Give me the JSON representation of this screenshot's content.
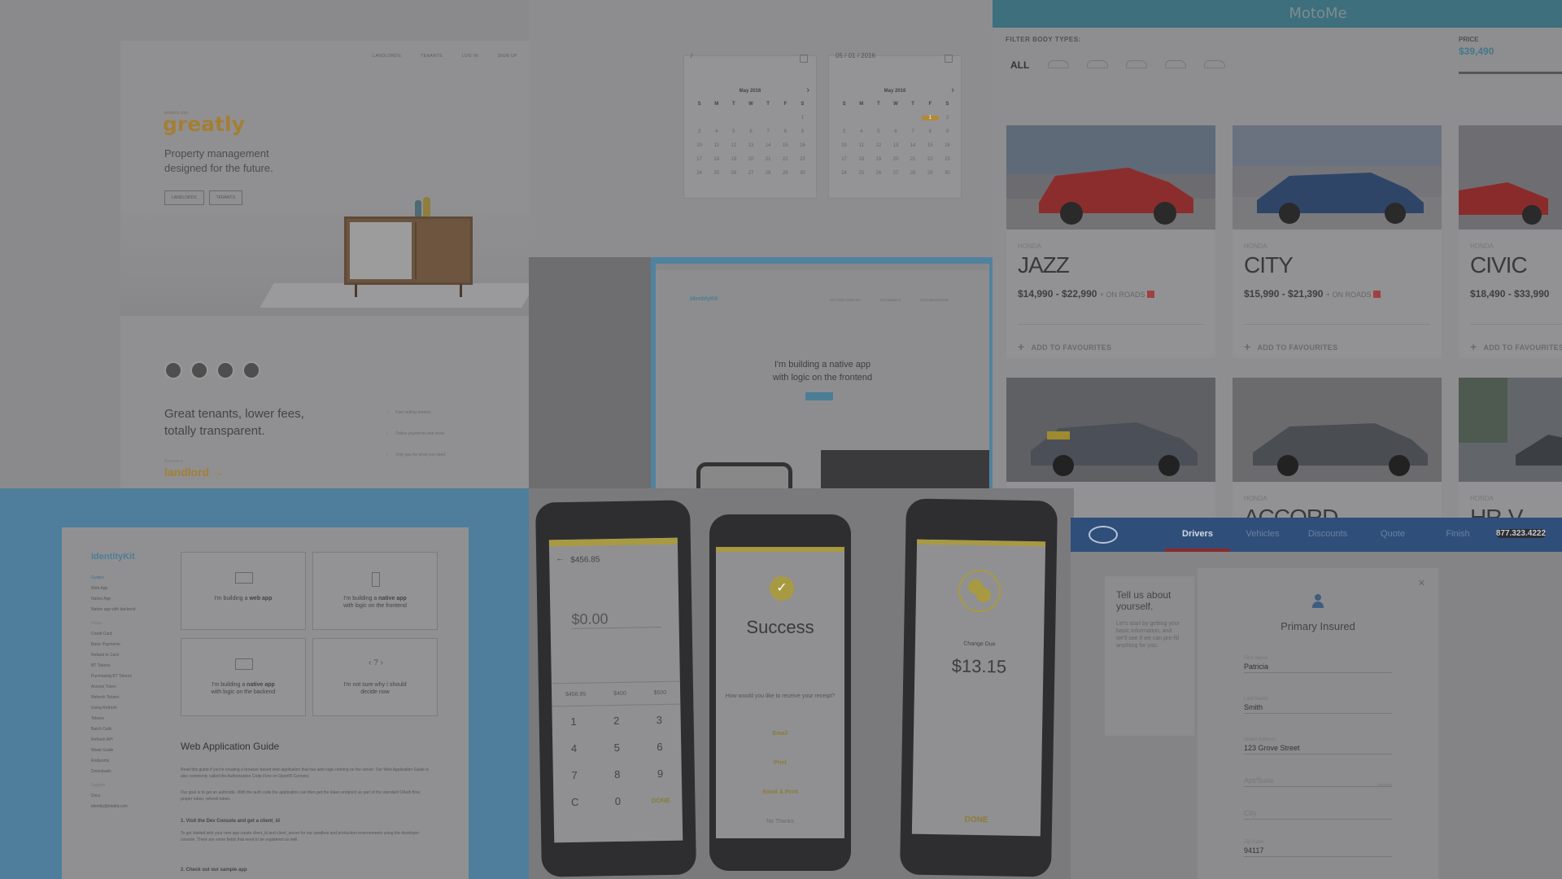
{
  "greatly": {
    "nav": [
      "LANDLORDS",
      "TENANTS",
      "LOG IN",
      "SIGN UP"
    ],
    "eyebrow": "property.com",
    "logo": "greatly",
    "tagline": "Property management designed for the future.",
    "buttons": [
      "LANDLORDS",
      "TENANTS"
    ],
    "headline": "Great tenants, lower fees, totally transparent.",
    "features": [
      "Fast vetting tenants",
      "Online payments and more",
      "Only pay for what you need"
    ],
    "eyebrow2": "Become a",
    "link": "landlord →"
  },
  "calendar": {
    "left_input": "/",
    "right_input": "05 / 01 / 2016",
    "month": "May 2016",
    "weekdays": [
      "S",
      "M",
      "T",
      "W",
      "T",
      "F",
      "S"
    ],
    "left_days": [
      "",
      "",
      "",
      "",
      "",
      "",
      "1",
      "3",
      "4",
      "5",
      "6",
      "7",
      "8",
      "9",
      "10",
      "11",
      "12",
      "13",
      "14",
      "15",
      "16",
      "17",
      "18",
      "19",
      "20",
      "21",
      "22",
      "23",
      "24",
      "25",
      "26",
      "27",
      "28",
      "29",
      "30"
    ],
    "right_days": [
      "",
      "",
      "",
      "",
      "",
      "1",
      "2",
      "3",
      "4",
      "5",
      "6",
      "7",
      "8",
      "9",
      "10",
      "11",
      "12",
      "13",
      "14",
      "15",
      "16",
      "17",
      "18",
      "19",
      "20",
      "21",
      "22",
      "23",
      "24",
      "25",
      "26",
      "27",
      "28",
      "29",
      "30"
    ],
    "selected": "1"
  },
  "identitykit_small": {
    "brand": "IdentityKit",
    "links": [
      "GETTING STARTED",
      "DOCUMENTS",
      "DOCUMENTATION"
    ],
    "message_line1": "I'm building a native app",
    "message_line2": "with logic on the frontend"
  },
  "motome": {
    "title": "MotoMe",
    "filter_label": "FILTER BODY TYPES:",
    "all": "ALL",
    "price_label": "PRICE",
    "price_value": "$39,490",
    "on_roads": "+ ON ROADS",
    "add_fav": "ADD TO FAVOURITES",
    "cars": [
      {
        "make": "HONDA",
        "model": "JAZZ",
        "range": "$14,990 - $22,990"
      },
      {
        "make": "HONDA",
        "model": "CITY",
        "range": "$15,990 - $21,390"
      },
      {
        "make": "HONDA",
        "model": "CIVIC",
        "range": "$18,490 - $33,990"
      }
    ],
    "cars_row2": [
      {
        "make": "HONDA",
        "model": "ACCORD"
      },
      {
        "make": "HONDA",
        "model": "HR-V"
      }
    ]
  },
  "identitykit_doc": {
    "brand": "IdentityKit",
    "sidebar": [
      "Guides",
      "Web App",
      "Native App",
      "Native app with backend",
      "Flows",
      "Credit Card",
      "Basic Payments",
      "Refund to Card",
      "BT Tokens",
      "Purchasing BT Tokens",
      "Access Token",
      "Refresh Tokens",
      "Using Refresh",
      "Tokens",
      "Batch Calls",
      "Refresh API",
      "Weak Guide",
      "Endpoints",
      "Downloads",
      "Support",
      "Docs",
      "identity@iotakit.com"
    ],
    "options": [
      {
        "label_plain": "I'm building a ",
        "label_bold": "web app",
        "label_tail": ""
      },
      {
        "label_plain": "I'm building a ",
        "label_bold": "native app",
        "label_tail": "with logic on the frontend"
      },
      {
        "label_plain": "I'm building a ",
        "label_bold": "native app",
        "label_tail": "with logic on the backend"
      },
      {
        "label_plain": "I'm not sure why I should",
        "label_bold": "",
        "label_tail": "decide now"
      }
    ],
    "guide_title": "Web Application Guide",
    "para1": "Read this guide if you're creating a browser-based web application that has web logic running on the server. Our Web Application Guide is also commonly called the Authorization Code Flow on OpenID Connect.",
    "para2": "Our goal is to get an authcode. With the auth code the application can then get the token endpoint as part of the standard OAuth flow, proper token, refresh token.",
    "step1": "1. Visit the Dev Console and get a client_id",
    "para3": "To get started with your new app create client_id and client_secret for our sandbox and production environments using the developer console. There are some fields that need to be registered as well.",
    "step2": "2. Check out our sample app"
  },
  "phones": {
    "p1_balance": "$456.85",
    "p1_amount": "$0.00",
    "p1_quick": [
      "$456.85",
      "$400",
      "$500"
    ],
    "p1_keys": [
      "1",
      "2",
      "3",
      "4",
      "5",
      "6",
      "7",
      "8",
      "9",
      "C",
      "0",
      "DONE"
    ],
    "p2_title": "Success",
    "p2_question": "How would you like to receive your receipt?",
    "p2_options": [
      "Email",
      "Print",
      "Email & Print",
      "No Thanks"
    ],
    "p3_label": "Change Due",
    "p3_amount": "$13.15",
    "p3_done": "DONE"
  },
  "aaa": {
    "tabs": [
      "Drivers",
      "Vehicles",
      "Discounts",
      "Quote",
      "Finish"
    ],
    "active_tab": "Drivers",
    "phone": "877.323.4222",
    "aside_title": "Tell us about yourself.",
    "aside_text": "Let's start by getting your basic information, and we'll see if we can pre-fill anything for you.",
    "form_title": "Primary Insured",
    "fields": [
      {
        "label": "First Name",
        "value": "Patricia"
      },
      {
        "label": "Last Name",
        "value": "Smith"
      },
      {
        "label": "Street Address",
        "value": "123 Grove Street"
      },
      {
        "label": "",
        "value": "Apt/Suite",
        "optional": "optional"
      },
      {
        "label": "",
        "value": "City"
      },
      {
        "label": "Zip Code",
        "value": "94117"
      }
    ]
  }
}
